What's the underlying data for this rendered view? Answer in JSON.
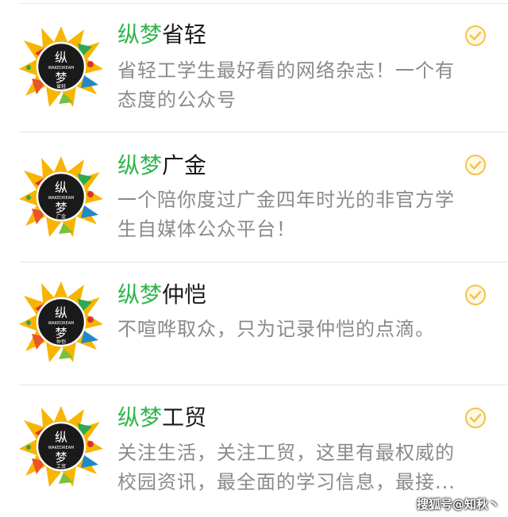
{
  "accounts": [
    {
      "brand": "纵梦",
      "campus": "省轻",
      "desc_lines": [
        "省轻工学生最好看的网络杂志！一个有",
        "态度的公众号"
      ],
      "badge_text": "省轻"
    },
    {
      "brand": "纵梦",
      "campus": "广金",
      "desc_lines": [
        "一个陪你度过广金四年时光的非官方学",
        "生自媒体公众平台！"
      ],
      "badge_text": "广金"
    },
    {
      "brand": "纵梦",
      "campus": "仲恺",
      "desc_lines": [
        "不喧哗取众，只为记录仲恺的点滴。"
      ],
      "badge_text": "仲恺"
    },
    {
      "brand": "纵梦",
      "campus": "工贸",
      "desc_lines": [
        "关注生活，关注工贸，这里有最权威的",
        "校园资讯，最全面的学习信息，最接..."
      ],
      "badge_text": "工贸"
    }
  ],
  "avatar_logo": {
    "top_char": "纵",
    "bottom_char": "梦",
    "banner": "WAKEDREAM"
  },
  "verified_icon": "check-circle-icon",
  "watermark": "搜狐号@知秋丶",
  "colors": {
    "brand_green": "#2fb54b",
    "desc_gray": "#8a8a8a",
    "check_yellow": "#f3c34a",
    "divider": "#e4e4e4"
  }
}
